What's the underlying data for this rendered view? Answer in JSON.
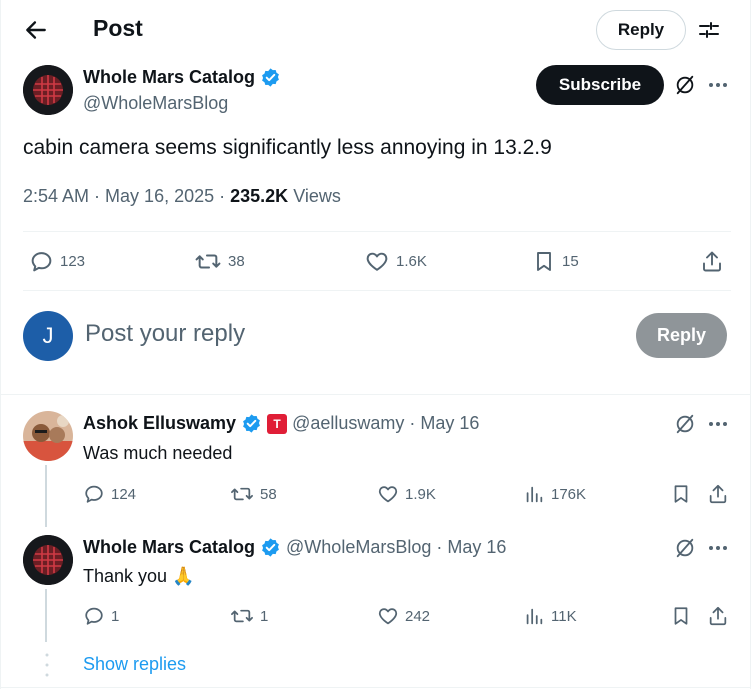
{
  "header": {
    "title": "Post",
    "reply_label": "Reply"
  },
  "post": {
    "author_name": "Whole Mars Catalog",
    "author_handle": "@WholeMarsBlog",
    "subscribe_label": "Subscribe",
    "text": "cabin camera seems significantly less annoying in 13.2.9",
    "time": "2:54 AM",
    "date": "May 16, 2025",
    "views_count": "235.2K",
    "views_label": "Views",
    "replies": "123",
    "reposts": "38",
    "likes": "1.6K",
    "bookmarks": "15"
  },
  "composer": {
    "avatar_letter": "J",
    "placeholder": "Post your reply",
    "reply_label": "Reply"
  },
  "comments": [
    {
      "name": "Ashok Elluswamy",
      "handle": "@aelluswamy",
      "date": "May 16",
      "text": "Was much needed",
      "replies": "124",
      "reposts": "58",
      "likes": "1.9K",
      "views": "176K"
    },
    {
      "name": "Whole Mars Catalog",
      "handle": "@WholeMarsBlog",
      "date": "May 16",
      "text": "Thank you 🙏",
      "replies": "1",
      "reposts": "1",
      "likes": "242",
      "views": "11K"
    }
  ],
  "show_replies_label": "Show replies",
  "colors": {
    "verified": "#1d9bf0",
    "link": "#1d9bf0",
    "text": "#0f1419",
    "muted": "#536471"
  }
}
